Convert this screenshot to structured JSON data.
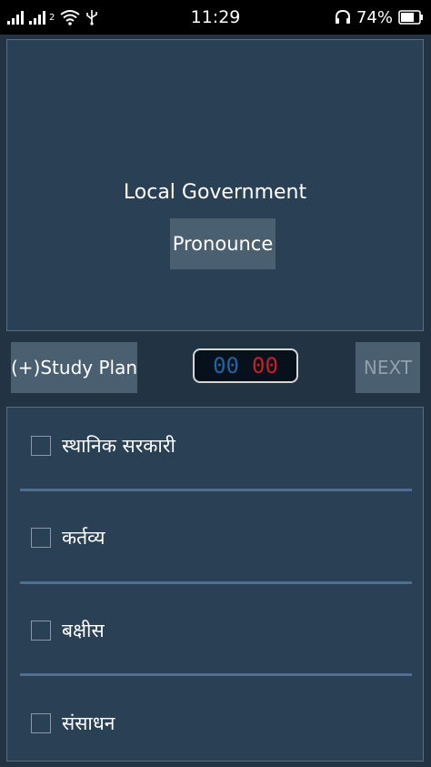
{
  "status_bar": {
    "time": "11:29",
    "battery": "74%",
    "sim2_label": "2",
    "icons": [
      "signal-icon",
      "signal-icon",
      "wifi-icon",
      "usb-icon",
      "headphones-icon",
      "battery-icon"
    ]
  },
  "card": {
    "word": "Local Government",
    "pronounce_label": "Pronounce"
  },
  "controls": {
    "study_plan_label": "(+)Study Plan",
    "timer_minutes": "00",
    "timer_seconds": "00",
    "next_label": "NEXT"
  },
  "options": [
    {
      "label": "स्थानिक सरकारी",
      "checked": false
    },
    {
      "label": "कर्तव्य",
      "checked": false
    },
    {
      "label": "बक्षीस",
      "checked": false
    },
    {
      "label": "संसाधन",
      "checked": false
    }
  ],
  "colors": {
    "background": "#223444",
    "panel": "#2a4054",
    "button": "#4a5f70",
    "divider": "#4f6f92",
    "timer_minutes": "#1e66a3",
    "timer_seconds": "#c2202a"
  }
}
